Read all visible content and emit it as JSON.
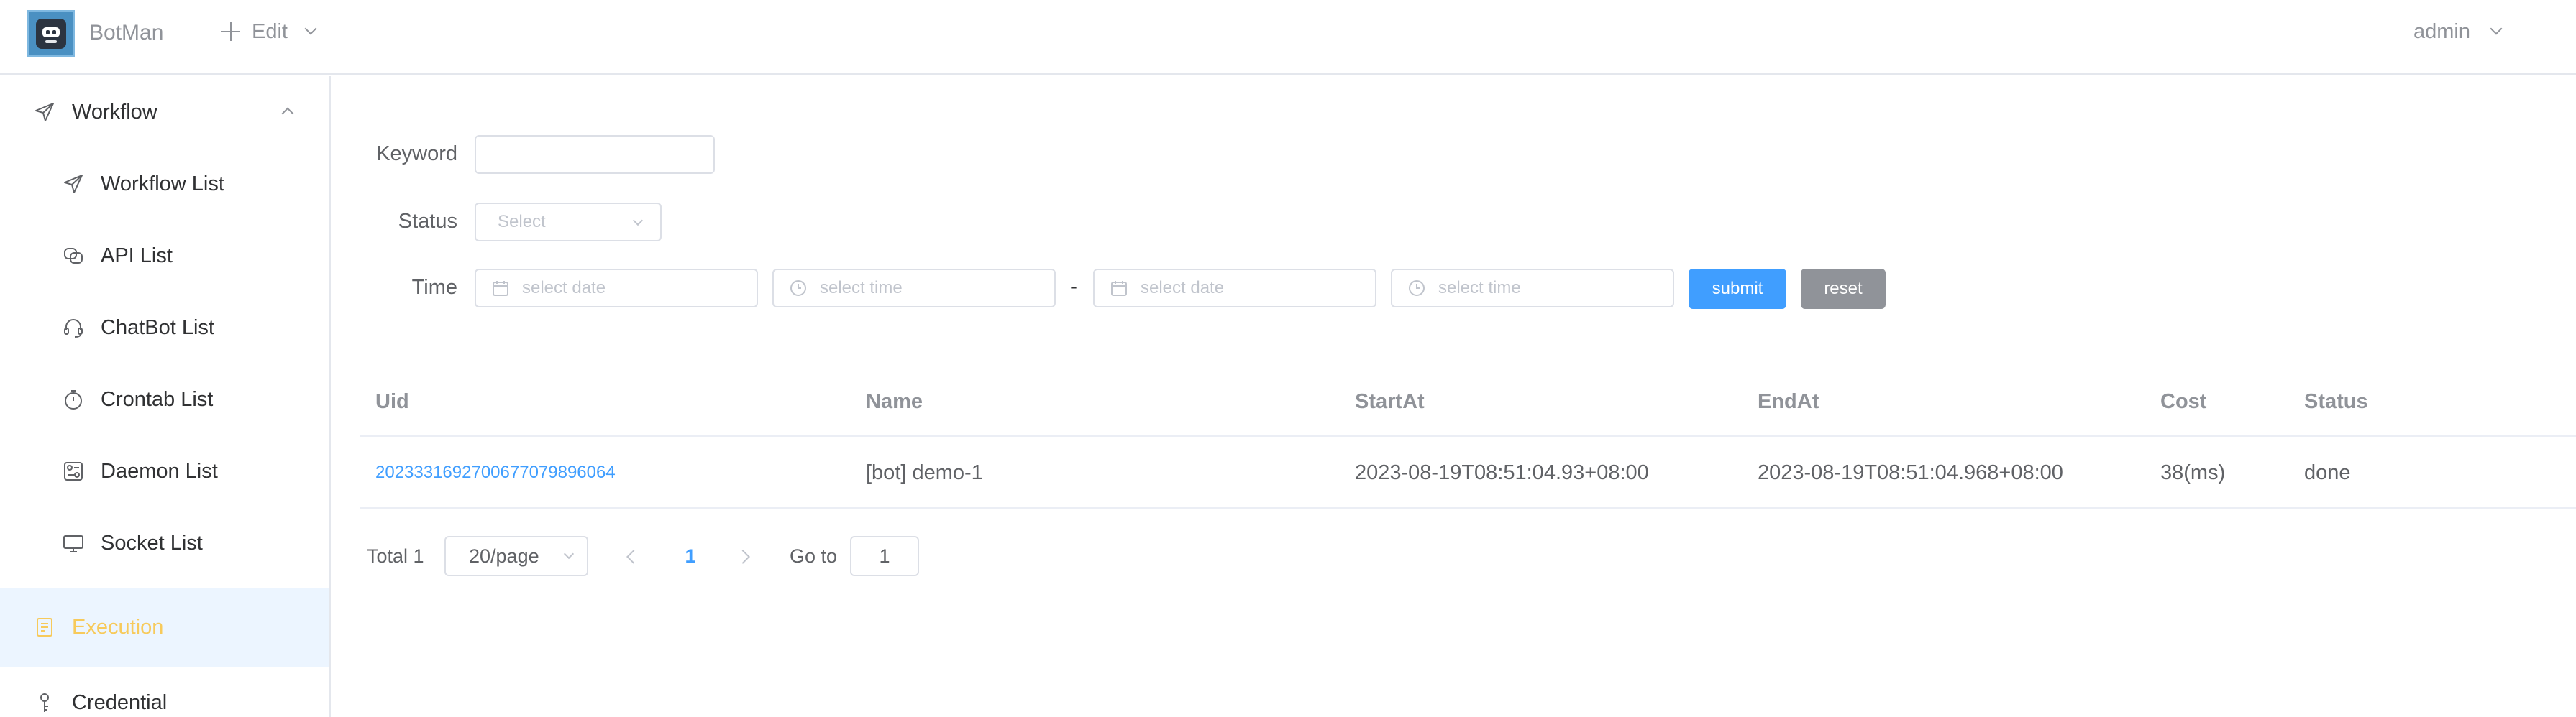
{
  "header": {
    "brand": "BotMan",
    "edit_label": "Edit",
    "user_label": "admin"
  },
  "sidebar": {
    "group": {
      "label": "Workflow",
      "icon": "send-icon"
    },
    "items": [
      {
        "label": "Workflow List",
        "icon": "send-icon"
      },
      {
        "label": "API List",
        "icon": "api-icon"
      },
      {
        "label": "ChatBot List",
        "icon": "headset-icon"
      },
      {
        "label": "Crontab List",
        "icon": "timer-icon"
      },
      {
        "label": "Daemon List",
        "icon": "daemon-icon"
      },
      {
        "label": "Socket List",
        "icon": "monitor-icon"
      }
    ],
    "execution": {
      "label": "Execution",
      "icon": "document-icon",
      "active": true
    },
    "credential": {
      "label": "Credential",
      "icon": "key-icon"
    }
  },
  "filters": {
    "keyword_label": "Keyword",
    "keyword_value": "",
    "status_label": "Status",
    "status_placeholder": "Select",
    "time_label": "Time",
    "start_date_placeholder": "select date",
    "start_time_placeholder": "select time",
    "range_separator": "-",
    "end_date_placeholder": "select date",
    "end_time_placeholder": "select time",
    "submit_label": "submit",
    "reset_label": "reset"
  },
  "table": {
    "columns": [
      "Uid",
      "Name",
      "StartAt",
      "EndAt",
      "Cost",
      "Status"
    ],
    "rows": [
      {
        "uid": "20233316927006770798960​64",
        "name": "[bot] demo-1",
        "start_at": "2023-08-19T08:51:04.93+08:00",
        "end_at": "2023-08-19T08:51:04.968+08:00",
        "cost": "38(ms)",
        "status": "done"
      }
    ]
  },
  "pagination": {
    "total_label": "Total 1",
    "page_size": "20/page",
    "current_page": "1",
    "goto_label": "Go to",
    "goto_value": "1"
  },
  "colors": {
    "primary": "#409eff",
    "active_menu_text": "#f7ca5b",
    "active_menu_bg": "#ecf5ff",
    "reset_button": "#909399"
  }
}
